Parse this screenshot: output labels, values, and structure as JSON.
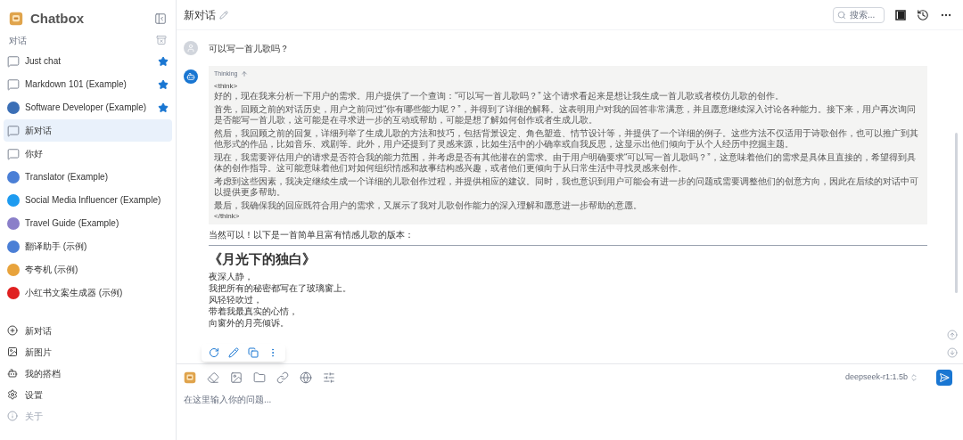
{
  "sidebar": {
    "app_name": "Chatbox",
    "section_label": "对话",
    "items": [
      {
        "label": "Just chat",
        "kind": "chat",
        "starred": true,
        "selected": false
      },
      {
        "label": "Markdown 101 (Example)",
        "kind": "chat",
        "starred": true,
        "selected": false
      },
      {
        "label": "Software Developer (Example)",
        "kind": "avatar",
        "color": "#3b6fb6",
        "starred": true,
        "selected": false
      },
      {
        "label": "新对话",
        "kind": "chat",
        "starred": false,
        "selected": true
      },
      {
        "label": "你好",
        "kind": "chat",
        "starred": false,
        "selected": false
      },
      {
        "label": "Translator (Example)",
        "kind": "avatar",
        "color": "#4a7fd6",
        "starred": false,
        "selected": false
      },
      {
        "label": "Social Media Influencer (Example)",
        "kind": "avatar",
        "color": "#1d9bf0",
        "starred": false,
        "selected": false
      },
      {
        "label": "Travel Guide (Example)",
        "kind": "avatar",
        "color": "#8a7fc9",
        "starred": false,
        "selected": false
      },
      {
        "label": "翻译助手 (示例)",
        "kind": "avatar",
        "color": "#4a7fd6",
        "starred": false,
        "selected": false
      },
      {
        "label": "夸夸机 (示例)",
        "kind": "avatar",
        "color": "#e8a33c",
        "starred": false,
        "selected": false
      },
      {
        "label": "小红书文案生成器 (示例)",
        "kind": "avatar",
        "color": "#e02020",
        "starred": false,
        "selected": false
      }
    ],
    "menu": [
      {
        "label": "新对话",
        "kind": "new-chat",
        "disabled": false
      },
      {
        "label": "新图片",
        "kind": "new-image",
        "disabled": false
      },
      {
        "label": "我的搭档",
        "kind": "partner",
        "disabled": false
      },
      {
        "label": "设置",
        "kind": "settings",
        "disabled": false
      },
      {
        "label": "关于",
        "kind": "about",
        "disabled": true
      }
    ]
  },
  "header": {
    "title": "新对话",
    "search": {
      "placeholder": "搜索..."
    }
  },
  "messages": [
    {
      "kind": "user",
      "text": "可以写一首儿歌吗？"
    },
    {
      "kind": "assistant",
      "thinking_label": "Thinking",
      "think_open": "<think>",
      "think_close": "</think>",
      "thinking": [
        "好的，现在我来分析一下用户的需求。用户提供了一个查询：“可以写一首儿歌吗？” 这个请求看起来是想让我生成一首儿歌或者模仿儿歌的创作。",
        "首先，回顾之前的对话历史，用户之前问过“你有哪些能力呢？”，并得到了详细的解释。这表明用户对我的回答非常满意，并且愿意继续深入讨论各种能力。接下来，用户再次询问是否能写一首儿歌，这可能是在寻求进一步的互动或帮助，可能是想了解如何创作或者生成儿歌。",
        "然后，我回顾之前的回复，详细列举了生成儿歌的方法和技巧，包括背景设定、角色塑造、情节设计等，并提供了一个详细的例子。这些方法不仅适用于诗歌创作，也可以推广到其他形式的作品，比如音乐、戏剧等。此外，用户还提到了灵感来源，比如生活中的小确幸或自我反思，这显示出他们倾向于从个人经历中挖掘主题。",
        "现在，我需要评估用户的请求是否符合我的能力范围，并考虑是否有其他潜在的需求。由于用户明确要求“可以写一首儿歌吗？”，这意味着他们的需求是具体且直接的，希望得到具体的创作指导。这可能意味着他们对如何组织情感和故事结构感兴趣，或者他们更倾向于从日常生活中寻找灵感来创作。",
        "考虑到这些因素，我决定继续生成一个详细的儿歌创作过程，并提供相应的建议。同时，我也意识到用户可能会有进一步的问题或需要调整他们的创意方向，因此在后续的对话中可以提供更多帮助。",
        "最后，我确保我的回应既符合用户的需求，又展示了我对儿歌创作能力的深入理解和愿意进一步帮助的意愿。"
      ],
      "intro": "当然可以！以下是一首简单且富有情感儿歌的版本：",
      "poem_title": "《月光下的独白》",
      "poem_lines": [
        "夜深人静，",
        "我把所有的秘密都写在了玻璃窗上。",
        "风轻轻吹过，",
        "带着我最真实的心情，",
        "向窗外的月亮倾诉。"
      ]
    }
  ],
  "composer": {
    "placeholder": "在这里输入你的问题...",
    "model": "deepseek-r1:1.5b"
  }
}
